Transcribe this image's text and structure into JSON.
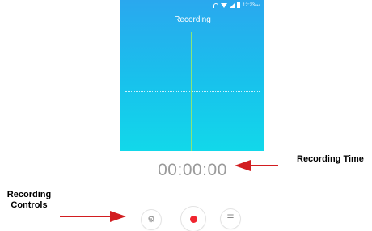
{
  "status_bar": {
    "time": "12:23",
    "time_suffix": "PM",
    "icons": [
      "headphone-icon",
      "wifi-icon",
      "signal-icon",
      "battery-icon"
    ]
  },
  "screen": {
    "title": "Recording",
    "gradient_top": "#2aa8ee",
    "gradient_bottom": "#12d8ea",
    "waveform_color": "#8ae57a"
  },
  "timer": {
    "value": "00:00:00"
  },
  "controls": {
    "settings_icon": "gear-icon",
    "record_icon": "record-dot-icon",
    "record_color": "#f0252f",
    "list_icon": "list-icon"
  },
  "annotations": {
    "time_label": "Recording Time",
    "controls_label_line1": "Recording",
    "controls_label_line2": "Controls",
    "arrow_color": "#d21d20"
  }
}
